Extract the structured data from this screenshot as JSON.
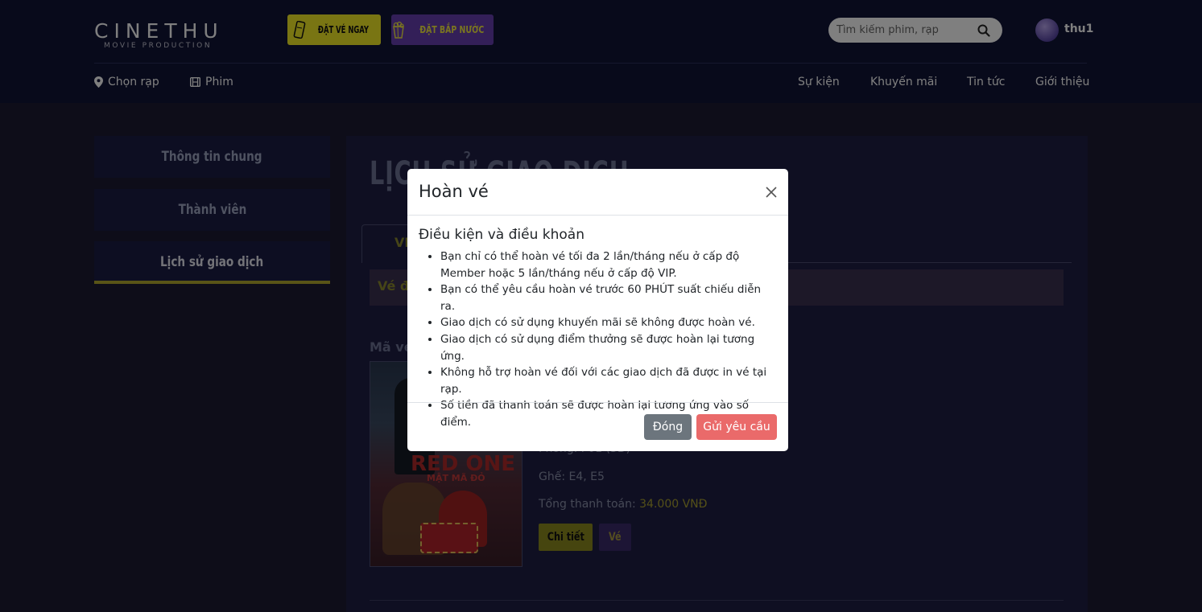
{
  "header": {
    "logo_main": "CINETHU",
    "logo_sub": "MOVIE PRODUCTION",
    "book_ticket_label": "ĐẶT VÉ NGAY",
    "book_popcorn_label": "ĐẶT BẮP NƯỚC",
    "search_placeholder": "Tìm kiếm phim, rạp",
    "username": "thu1",
    "nav_left": [
      {
        "label": "Chọn rạp",
        "icon": "map-pin-icon"
      },
      {
        "label": "Phim",
        "icon": "film-icon"
      }
    ],
    "nav_right": [
      "Sự kiện",
      "Khuyến mãi",
      "Tin tức",
      "Giới thiệu"
    ]
  },
  "sidebar": {
    "items": [
      {
        "label": "Thông tin chung",
        "active": false
      },
      {
        "label": "Thành viên",
        "active": false
      },
      {
        "label": "Lịch sử giao dịch",
        "active": true
      }
    ]
  },
  "main": {
    "title": "LỊCH SỬ GIAO DỊCH",
    "tab_label": "VÉ",
    "notice_label": "Vé đ",
    "ticket_code_label": "Mã vé",
    "poster": {
      "title": "RED ONE",
      "subtitle": "MẬT MÃ ĐỎ"
    },
    "ticket": {
      "room": "Phòng: P01 (3D)",
      "seats": "Ghế: E4, E5",
      "total_label": "Tổng thanh toán: ",
      "total_value": "34.000 VNĐ"
    },
    "detail_button": "Chi tiết",
    "ticket_button": "Vé"
  },
  "modal": {
    "title": "Hoàn vé",
    "subtitle": "Điều kiện và điều khoản",
    "terms": [
      "Bạn chỉ có thể hoàn vé tối đa 2 lần/tháng nếu ở cấp độ Member hoặc 5 lần/tháng nếu ở cấp độ VIP.",
      "Bạn có thể yêu cầu hoàn vé trước 60 PHÚT suất chiếu diễn ra.",
      "Giao dịch có sử dụng khuyến mãi sẽ không được hoàn vé.",
      "Giao dịch có sử dụng điểm thưởng sẽ được hoàn lại tương ứng.",
      "Không hỗ trợ hoàn vé đối với các giao dịch đã được in vé tại rạp.",
      "Số tiền đã thanh toán sẽ được hoàn lại tương ứng vào số điểm."
    ],
    "close_label": "Đóng",
    "submit_label": "Gửi yêu cầu"
  },
  "colors": {
    "header_bg": "#111437",
    "accent_yellow": "#f3ea27",
    "accent_purple": "#663fb1",
    "submit_red": "#ea6a6a",
    "close_gray": "#6c757d"
  }
}
